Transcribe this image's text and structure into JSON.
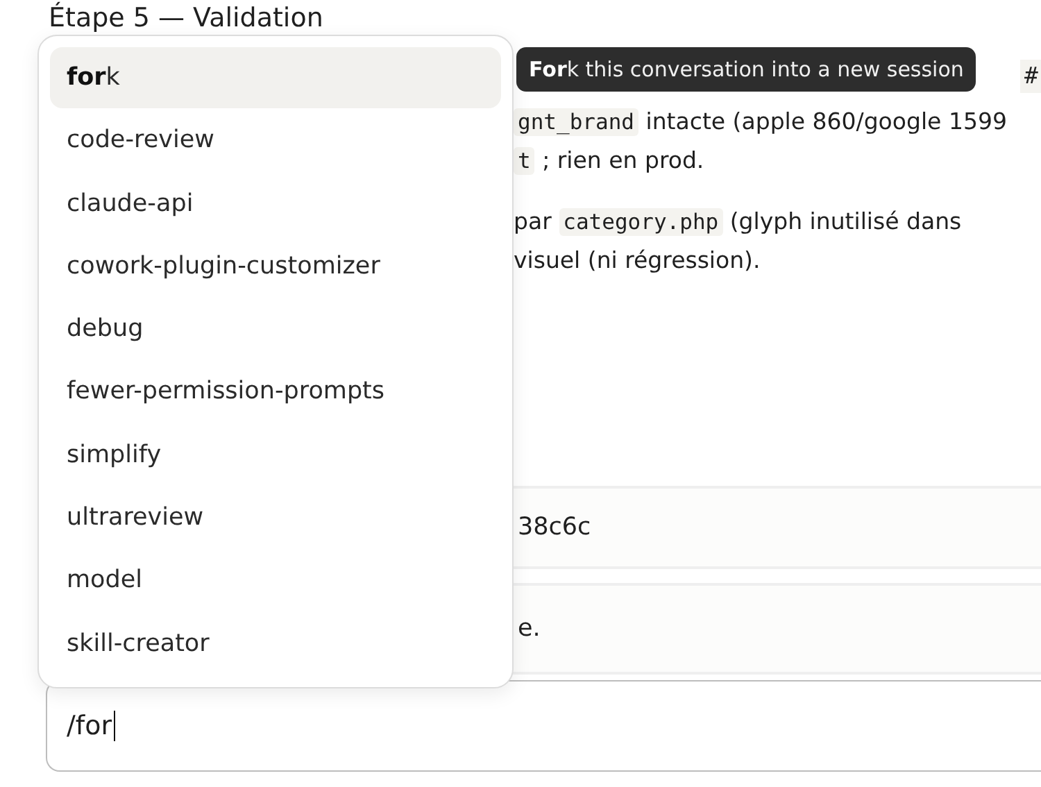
{
  "heading": "Étape 5 — Validation",
  "content": {
    "paragraphs": [
      {
        "lines": [
          {
            "segments": [
              {
                "kind": "code",
                "text": "gnt_brand"
              },
              {
                "kind": "text",
                "text": " intacte (apple 860/google 1599"
              }
            ]
          },
          {
            "segments": [
              {
                "kind": "code",
                "text": "t"
              },
              {
                "kind": "text",
                "text": " ; rien en prod."
              }
            ]
          }
        ]
      },
      {
        "lines": [
          {
            "segments": [
              {
                "kind": "text",
                "text": "par "
              },
              {
                "kind": "code",
                "text": "category.php"
              },
              {
                "kind": "text",
                "text": " (glyph inutilisé dans"
              }
            ]
          },
          {
            "segments": [
              {
                "kind": "text",
                "text": "visuel (ni régression)."
              }
            ]
          }
        ]
      }
    ]
  },
  "cards": [
    {
      "text": "38c6c"
    },
    {
      "text": "e."
    }
  ],
  "command_menu": {
    "items": [
      {
        "label": "**for**k",
        "selected": true
      },
      {
        "label": "code-review",
        "selected": false
      },
      {
        "label": "claude-api",
        "selected": false
      },
      {
        "label": "cowork-plugin-customizer",
        "selected": false
      },
      {
        "label": "debug",
        "selected": false
      },
      {
        "label": "fewer-permission-prompts",
        "selected": false
      },
      {
        "label": "simplify",
        "selected": false
      },
      {
        "label": "ultrareview",
        "selected": false
      },
      {
        "label": "model",
        "selected": false
      },
      {
        "label": "skill-creator",
        "selected": false
      }
    ]
  },
  "tooltip": "**For**k this conversation into a new session",
  "trailing_text": "#",
  "input": {
    "value": "/for"
  }
}
